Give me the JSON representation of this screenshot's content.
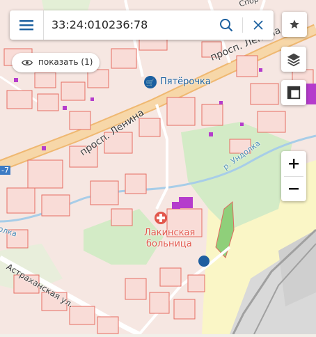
{
  "search": {
    "query": "33:24:010236:78"
  },
  "show_button": {
    "label": "показать (1)"
  },
  "map_labels": {
    "lenina_1": "просп. Ленина",
    "lenina_2": "просп. Ленина",
    "pyaterochka": "Пятёрочка",
    "river": "р. Ундолка",
    "hospital_1": "Лакинская",
    "hospital_2": "больница",
    "astrakhanskaya": "Астраханская ул.",
    "route_edge": "-7",
    "olka": "олка",
    "sport_top": "Спор"
  },
  "icons": {
    "menu": "menu-icon",
    "search": "search-icon",
    "clear": "close-icon",
    "favorite": "star-icon",
    "layers": "layers-icon",
    "measure": "ruler-icon",
    "eye": "eye-icon",
    "store": "cart-icon",
    "hospital": "hospital-cross-icon"
  },
  "colors": {
    "accent": "#1a5f9e",
    "parcel_fill": "#f7ddd9",
    "parcel_stroke": "#e0685f",
    "main_road": "#f2c48a",
    "park": "#cfe8c4",
    "water": "#9cc8e6",
    "field": "#faf5c5",
    "building_violet": "#b23ccc",
    "location_dot": "#1f5fa0"
  }
}
